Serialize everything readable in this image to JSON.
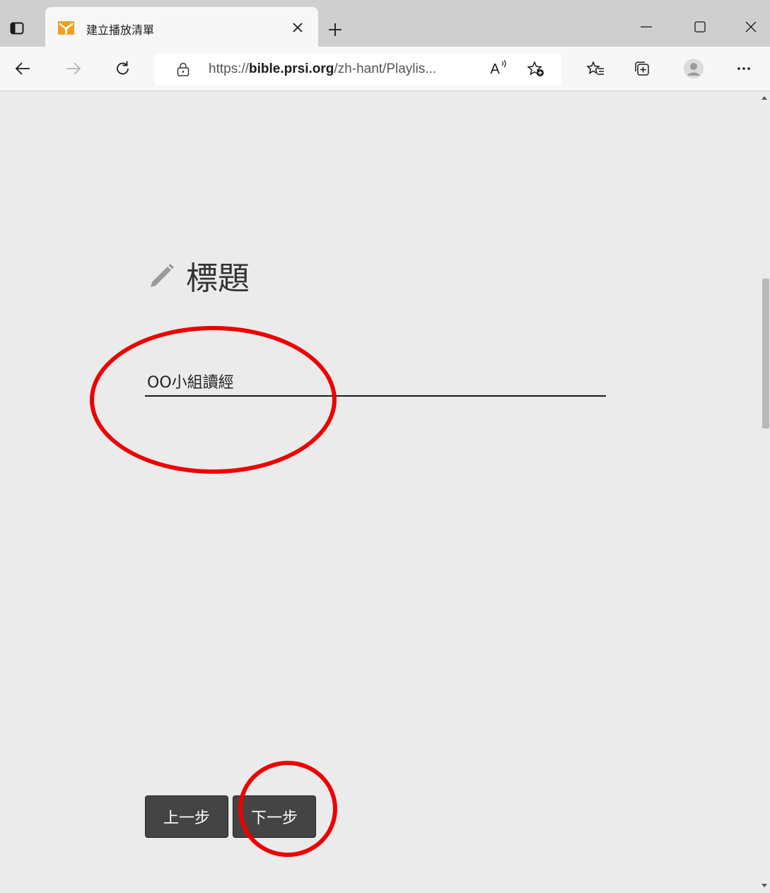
{
  "browser": {
    "tab_title": "建立播放清單",
    "url_prefix": "https://",
    "url_domain": "bible.prsi.org",
    "url_path": "/zh-hant/Playlis...",
    "read_aloud_label": "A"
  },
  "page": {
    "heading": "標題",
    "title_input_value": "OO小組讀經",
    "prev_label": "上一步",
    "next_label": "下一步"
  },
  "colors": {
    "annotation": "#ee0000",
    "button_bg": "#444444",
    "favicon": "#f0a020"
  }
}
